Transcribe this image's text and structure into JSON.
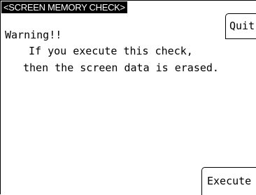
{
  "screen": {
    "title": "<SCREEN MEMORY CHECK>"
  },
  "buttons": {
    "quit_label": "Quit",
    "execute_label": "Execute"
  },
  "warning": {
    "heading": "Warning!!",
    "line1": "If you execute this check,",
    "line2": "then the screen data is erased."
  }
}
